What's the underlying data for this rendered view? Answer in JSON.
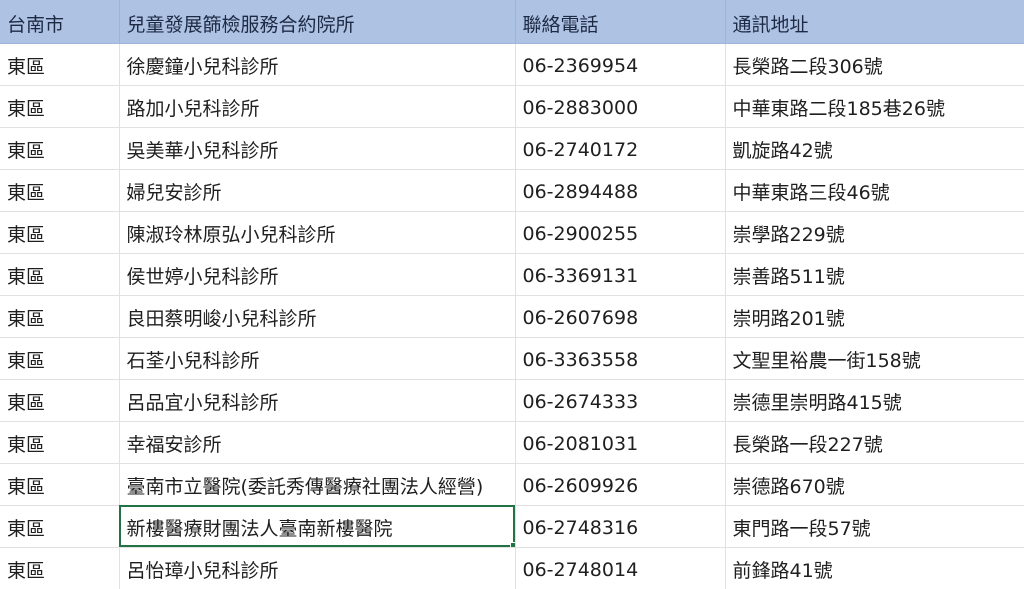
{
  "columns": [
    "台南市",
    "兒童發展篩檢服務合約院所",
    "聯絡電話",
    "通訊地址"
  ],
  "rows": [
    [
      "東區",
      "徐慶鐘小兒科診所",
      "06-2369954",
      "長榮路二段306號"
    ],
    [
      "東區",
      "路加小兒科診所",
      "06-2883000",
      "中華東路二段185巷26號"
    ],
    [
      "東區",
      "吳美華小兒科診所",
      "06-2740172",
      "凱旋路42號"
    ],
    [
      "東區",
      "婦兒安診所",
      "06-2894488",
      "中華東路三段46號"
    ],
    [
      "東區",
      "陳淑玲林原弘小兒科診所",
      "06-2900255",
      "崇學路229號"
    ],
    [
      "東區",
      "侯世婷小兒科診所",
      "06-3369131",
      "崇善路511號"
    ],
    [
      "東區",
      "良田蔡明峻小兒科診所",
      "06-2607698",
      "崇明路201號"
    ],
    [
      "東區",
      "石荃小兒科診所",
      "06-3363558",
      "文聖里裕農一街158號"
    ],
    [
      "東區",
      "呂品宜小兒科診所",
      "06-2674333",
      "崇德里崇明路415號"
    ],
    [
      "東區",
      "幸福安診所",
      "06-2081031",
      "長榮路一段227號"
    ],
    [
      "東區",
      "臺南市立醫院(委託秀傳醫療社團法人經營)",
      "06-2609926",
      "崇德路670號"
    ],
    [
      "東區",
      "新樓醫療財團法人臺南新樓醫院",
      "06-2748316",
      "東門路一段57號"
    ],
    [
      "東區",
      "呂怡璋小兒科診所",
      "06-2748014",
      "前鋒路41號"
    ]
  ],
  "selected_cell": {
    "row": 11,
    "col": 1
  },
  "colors": {
    "header_bg": "#aec2e3",
    "gridline": "#e1e1e1",
    "selection": "#217346"
  }
}
